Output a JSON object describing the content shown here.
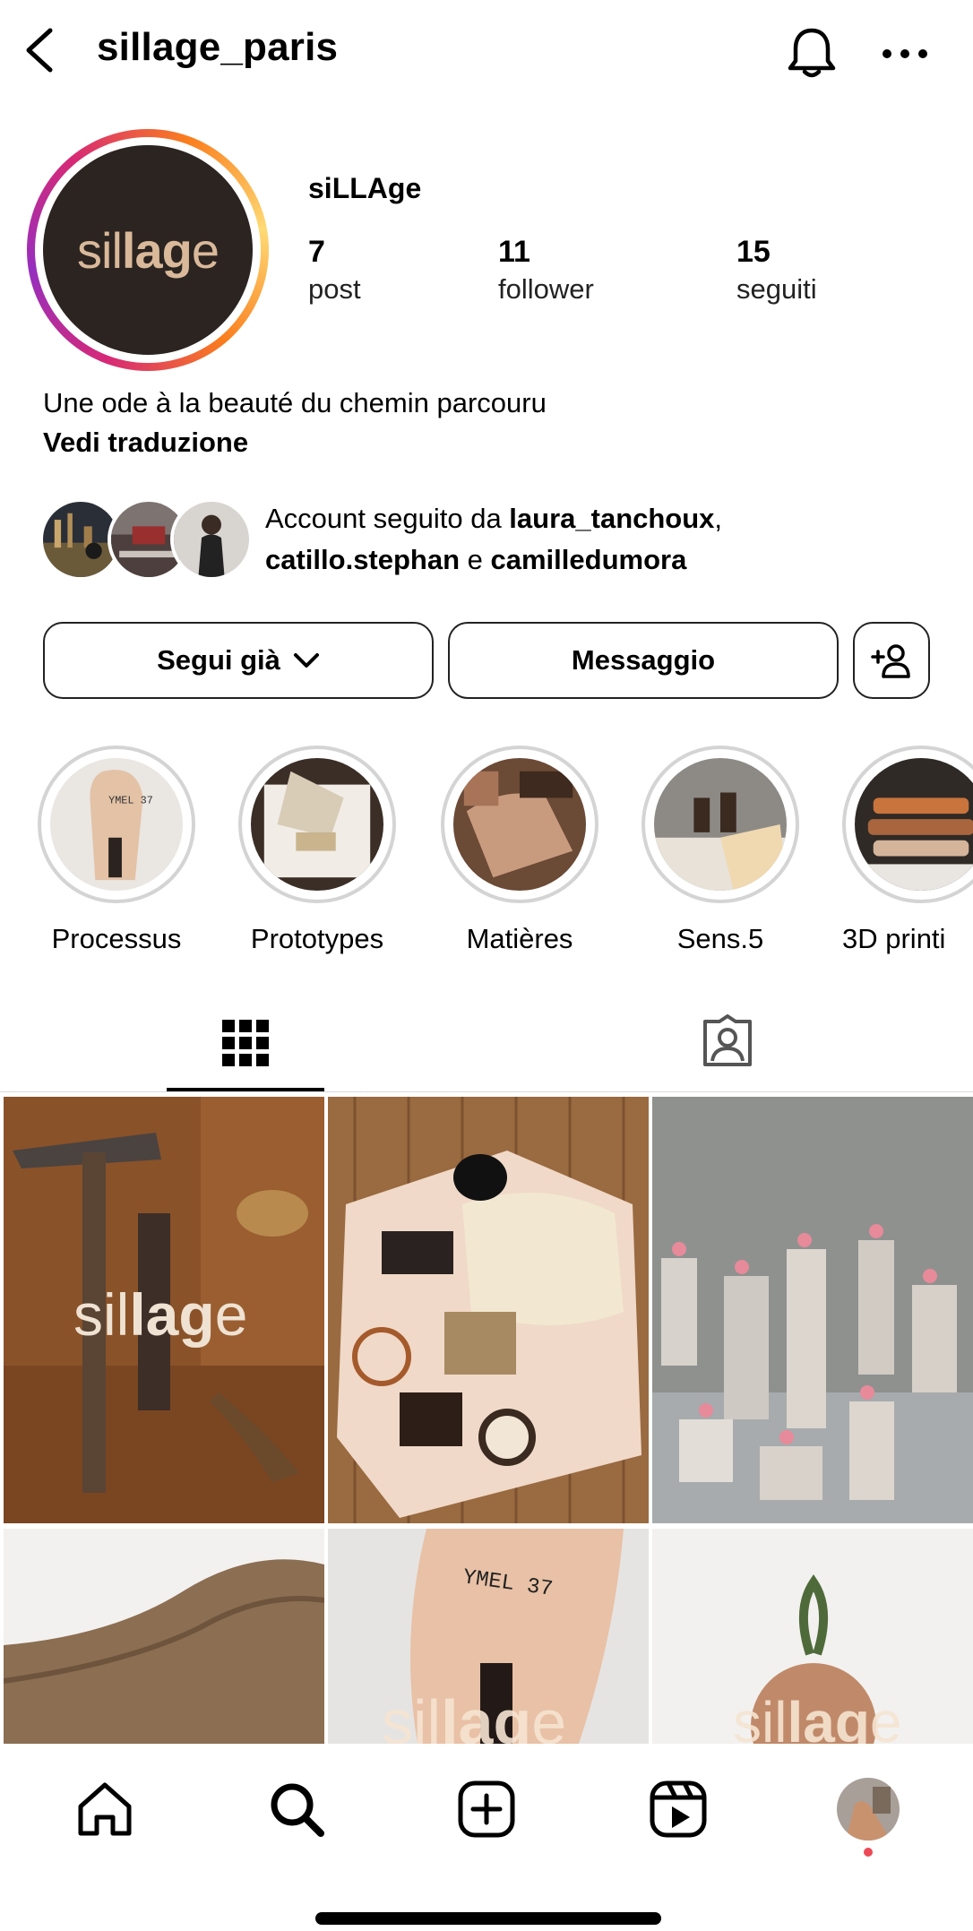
{
  "header": {
    "username": "sillage_paris",
    "back_icon": "chevron-left-icon",
    "bell_icon": "bell-icon",
    "more_icon": "more-horizontal-icon"
  },
  "profile": {
    "display_name": "siLLAge",
    "avatar_logo_light": "sil",
    "avatar_logo_bold": "lag",
    "avatar_logo_end": "e",
    "stats": [
      {
        "value": "7",
        "label": "post"
      },
      {
        "value": "11",
        "label": "follower"
      },
      {
        "value": "15",
        "label": "seguiti"
      }
    ],
    "bio": "Une ode à la beauté du chemin parcouru",
    "translate_label": "Vedi traduzione",
    "followed_by_prefix": "Account seguito da ",
    "followed_user_1": "laura_tanchoux",
    "followed_comma": ",",
    "followed_user_2": "catillo.stephan",
    "followed_and": " e ",
    "followed_user_3": "camilledumora"
  },
  "actions": {
    "follow_label": "Segui già",
    "message_label": "Messaggio",
    "add_person_icon": "add-person-icon"
  },
  "highlights": [
    {
      "label": "Processus"
    },
    {
      "label": "Prototypes"
    },
    {
      "label": "Matières"
    },
    {
      "label": "Sens.5"
    },
    {
      "label": "3D printi"
    }
  ],
  "tabs": {
    "grid_icon": "grid-icon",
    "tagged_icon": "tagged-person-icon"
  },
  "posts": [
    {
      "overlay": "sillage"
    },
    {
      "overlay": ""
    },
    {
      "overlay": ""
    },
    {
      "overlay": ""
    },
    {
      "overlay": "sillage",
      "stamp": "YMEL 37"
    },
    {
      "overlay": "sillage"
    }
  ],
  "nav": [
    "home-icon",
    "search-icon",
    "create-icon",
    "reels-icon",
    "profile-avatar"
  ],
  "colors": {
    "notification_dot": "#ed4956",
    "brand_dark": "#2b2420",
    "brand_tan": "#d9b99a"
  }
}
